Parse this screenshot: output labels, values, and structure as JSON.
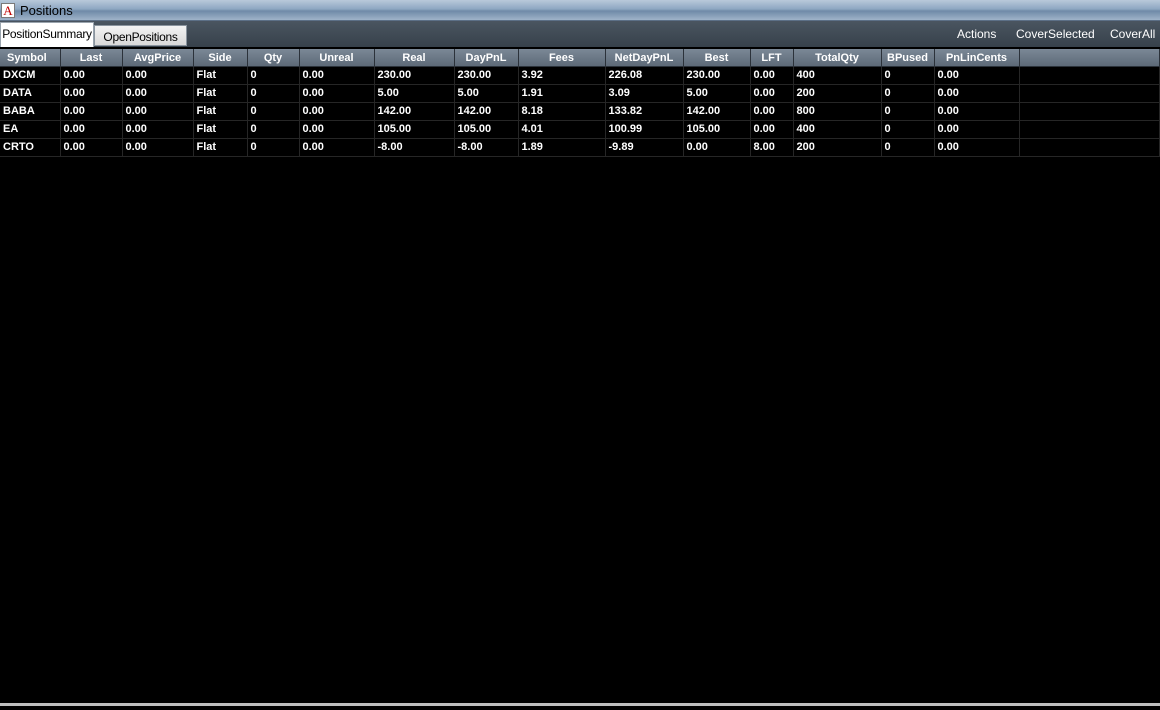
{
  "window": {
    "title": "Positions",
    "icon_letter": "A"
  },
  "tabs": [
    {
      "label": "PositionSummary",
      "active": true
    },
    {
      "label": "OpenPositions",
      "active": false
    }
  ],
  "toolbar": {
    "actions_label": "Actions",
    "cover_selected_label": "CoverSelected",
    "cover_all_label": "CoverAll"
  },
  "table": {
    "columns": [
      "Symbol",
      "Last",
      "AvgPrice",
      "Side",
      "Qty",
      "Unreal",
      "Real",
      "DayPnL",
      "Fees",
      "NetDayPnL",
      "Best",
      "LFT",
      "TotalQty",
      "BPused",
      "PnLinCents"
    ],
    "rows": [
      [
        "DXCM",
        "0.00",
        "0.00",
        "Flat",
        "0",
        "0.00",
        "230.00",
        "230.00",
        "3.92",
        "226.08",
        "230.00",
        "0.00",
        "400",
        "0",
        "0.00"
      ],
      [
        "DATA",
        "0.00",
        "0.00",
        "Flat",
        "0",
        "0.00",
        "5.00",
        "5.00",
        "1.91",
        "3.09",
        "5.00",
        "0.00",
        "200",
        "0",
        "0.00"
      ],
      [
        "BABA",
        "0.00",
        "0.00",
        "Flat",
        "0",
        "0.00",
        "142.00",
        "142.00",
        "8.18",
        "133.82",
        "142.00",
        "0.00",
        "800",
        "0",
        "0.00"
      ],
      [
        "EA",
        "0.00",
        "0.00",
        "Flat",
        "0",
        "0.00",
        "105.00",
        "105.00",
        "4.01",
        "100.99",
        "105.00",
        "0.00",
        "400",
        "0",
        "0.00"
      ],
      [
        "CRTO",
        "0.00",
        "0.00",
        "Flat",
        "0",
        "0.00",
        "-8.00",
        "-8.00",
        "1.89",
        "-9.89",
        "0.00",
        "8.00",
        "200",
        "0",
        "0.00"
      ]
    ]
  },
  "colors": {
    "positive": "#8cc63f",
    "negative": "#ff3b1f",
    "text": "#ffffff",
    "background": "#000000"
  }
}
